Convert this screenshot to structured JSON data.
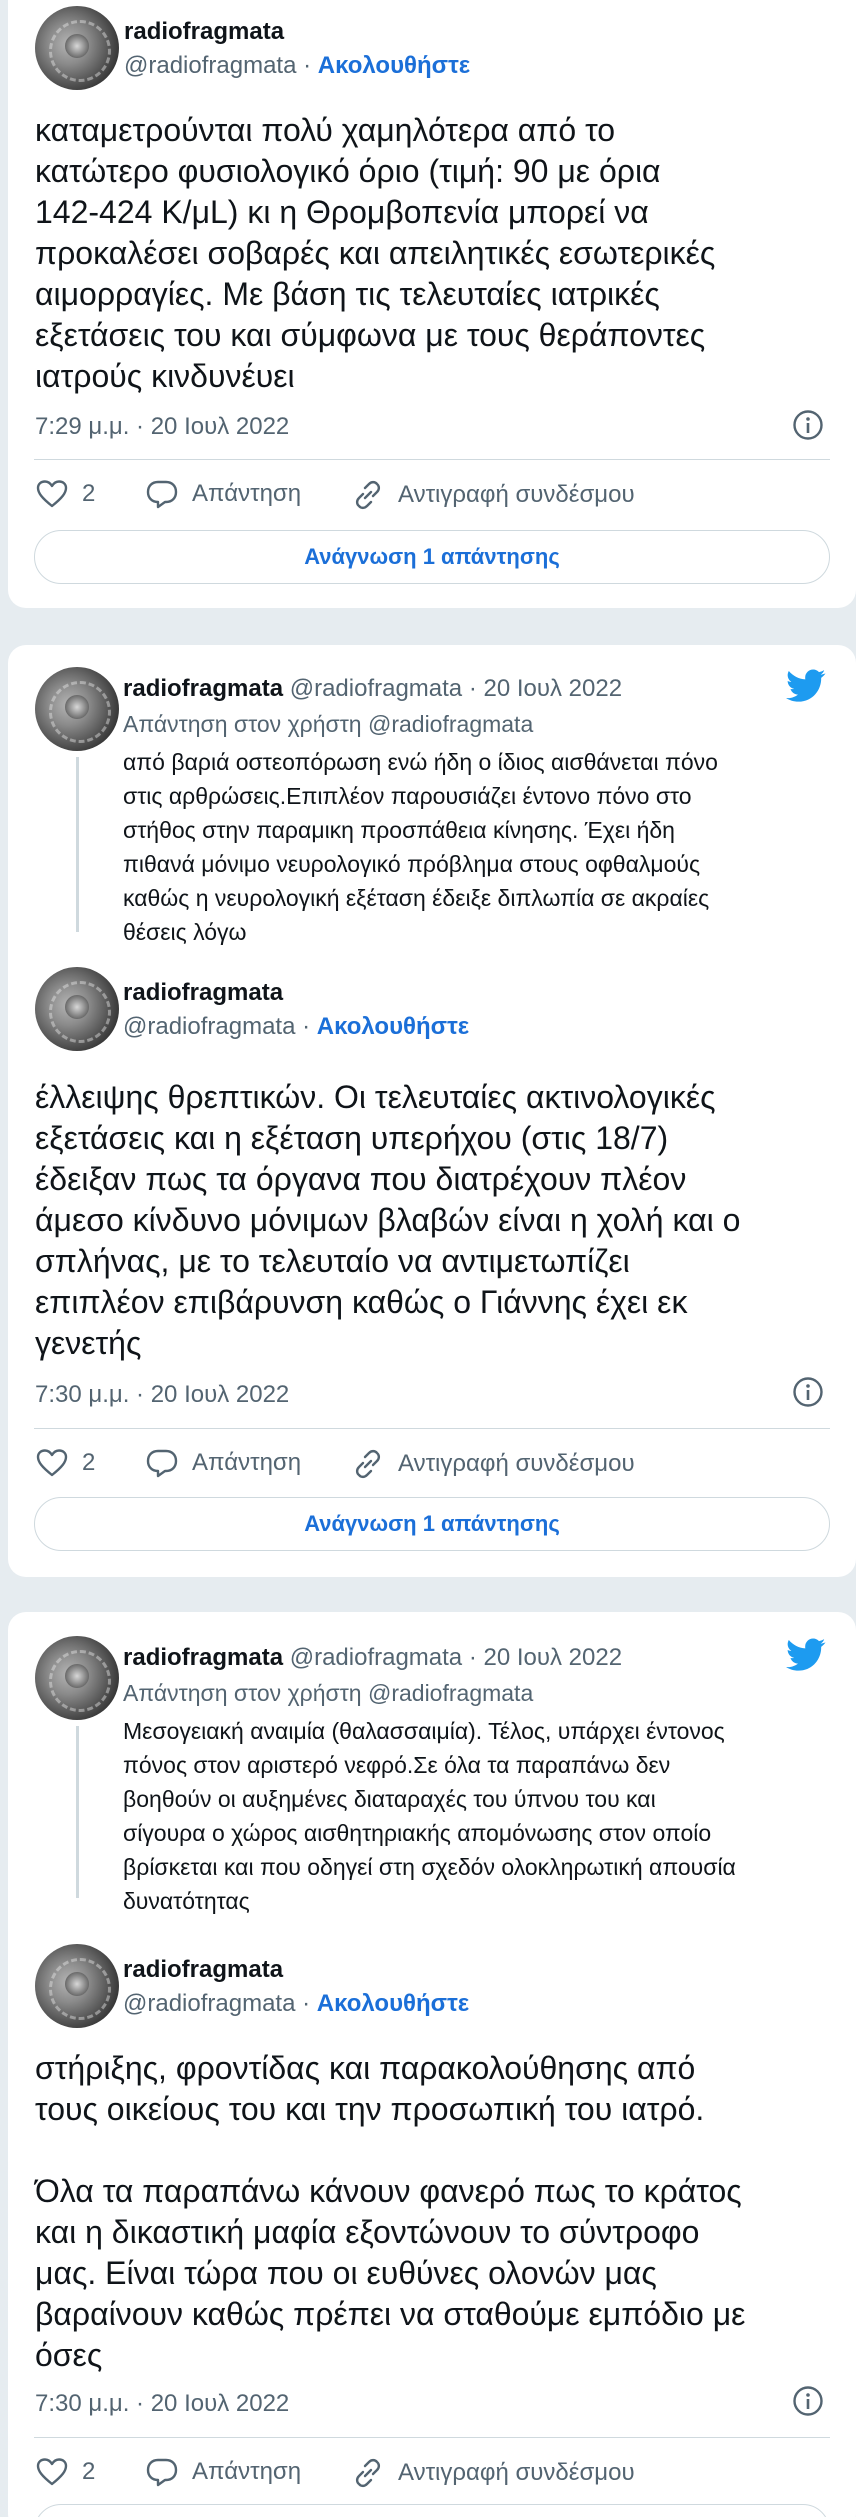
{
  "tweet1": {
    "name": "radiofragmata",
    "handle": "@radiofragmata",
    "follow_sep": " · ",
    "follow": "Ακολουθήστε",
    "text": "καταμετρούνται πολύ χαμηλότερα από το\nκατώτερο φυσιολογικό όριο (τιμή: 90 με όρια\n142-424 K/μL) κι η Θρομβοπενία μπορεί να\nπροκαλέσει σοβαρές και απειλητικές εσωτερικές\nαιμορραγίες. Με βάση τις τελευταίες ιατρικές\nεξετάσεις του και σύμφωνα με τους θεράποντες\nιατρούς κινδυνέυει",
    "time": "7:29 μ.μ. · 20 Ιουλ 2022",
    "likes": "2",
    "reply_label": "Απάντηση",
    "copy_label": "Αντιγραφή συνδέσμου",
    "read_label": "Ανάγνωση 1 απάντησης"
  },
  "tweet2": {
    "reply": {
      "name": "radiofragmata",
      "meta": " @radiofragmata · 20 Ιουλ 2022",
      "reply_to": "Απάντηση στον χρήστη @radiofragmata",
      "text": "από βαριά οστεοπόρωση ενώ ήδη ο ίδιος αισθάνεται πόνο\nστις αρθρώσεις.Επιπλέον παρουσιάζει έντονο πόνο στο\nστήθος στην παραμικη προσπάθεια κίνησης. Έχει ήδη\nπιθανά μόνιμο νευρολογικό πρόβλημα στους οφθαλμούς\nκαθώς η νευρολογική εξέταση έδειξε διπλωπία σε ακραίες\nθέσεις λόγω"
    },
    "name": "radiofragmata",
    "handle": "@radiofragmata",
    "follow_sep": " · ",
    "follow": "Ακολουθήστε",
    "text": "έλλειψης θρεπτικών. Οι τελευταίες ακτινολογικές\nεξετάσεις και η εξέταση υπερήχου (στις 18/7)\nέδειξαν πως τα όργανα που διατρέχουν πλέον\nάμεσο κίνδυνο μόνιμων βλαβών είναι η χολή και ο\nσπλήνας, με το τελευταίο να αντιμετωπίζει\nεπιπλέον επιβάρυνση καθώς ο Γιάννης έχει εκ\nγενετής",
    "time": "7:30 μ.μ. · 20 Ιουλ 2022",
    "likes": "2",
    "reply_label": "Απάντηση",
    "copy_label": "Αντιγραφή συνδέσμου",
    "read_label": "Ανάγνωση 1 απάντησης"
  },
  "tweet3": {
    "reply": {
      "name": "radiofragmata",
      "meta": " @radiofragmata · 20 Ιουλ 2022",
      "reply_to": "Απάντηση στον χρήστη @radiofragmata",
      "text": "Μεσογειακή αναιμία (θαλασσαιμία). Τέλος, υπάρχει έντονος\nπόνος στον αριστερό νεφρό.Σε όλα τα παραπάνω δεν\nβοηθούν οι αυξημένες διαταραχές του ύπνου του και\nσίγουρα ο χώρος αισθητηριακής απομόνωσης στον οποίο\nβρίσκεται και που οδηγεί στη σχεδόν ολοκληρωτική απουσία\nδυνατότητας"
    },
    "name": "radiofragmata",
    "handle": "@radiofragmata",
    "follow_sep": " · ",
    "follow": "Ακολουθήστε",
    "text": "στήριξης, φροντίδας και παρακολούθησης από\nτους οικείους του και την προσωπική του ιατρό.\n\nΌλα τα παραπάνω κάνουν φανερό πως το κράτος\nκαι η δικαστική μαφία εξοντώνουν το σύντροφο\nμας. Είναι τώρα που οι ευθύνες ολονών μας\nβαραίνουν καθώς πρέπει να σταθούμε εμπόδιο με\nόσες",
    "time": "7:30 μ.μ. · 20 Ιουλ 2022",
    "likes": "2",
    "reply_label": "Απάντηση",
    "copy_label": "Αντιγραφή συνδέσμου"
  },
  "colors": {
    "background": "#e6ecf0",
    "link": "#1b6fd8",
    "twitter_blue": "#1d9bf0",
    "muted": "#536471"
  },
  "icons": [
    "heart-icon",
    "reply-bubble-icon",
    "link-icon",
    "info-icon",
    "twitter-bird-icon"
  ]
}
